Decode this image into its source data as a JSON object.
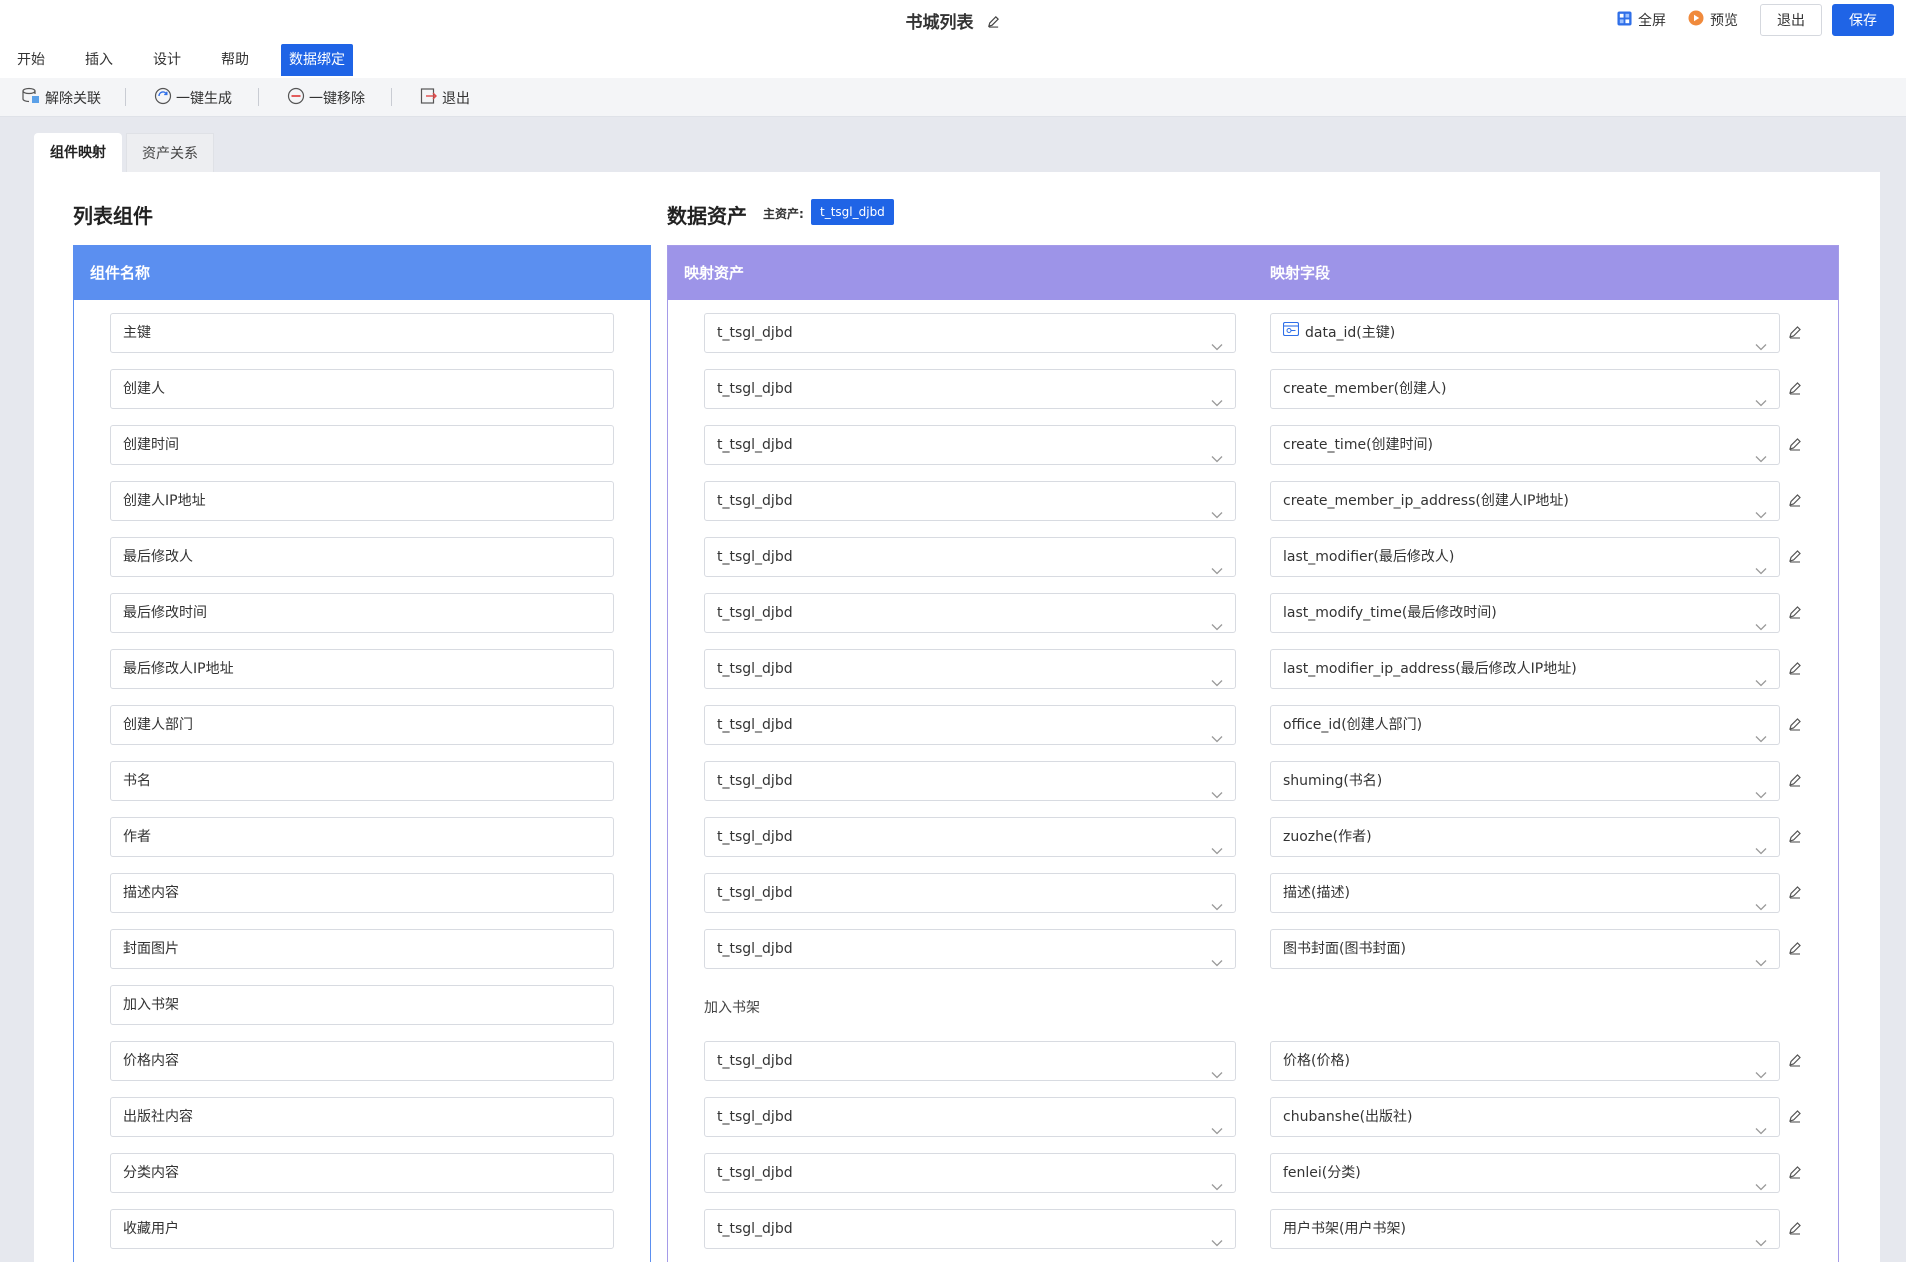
{
  "app": {
    "title": "书城列表",
    "fullscreen": "全屏",
    "preview": "预览",
    "exit": "退出",
    "save": "保存"
  },
  "menu": [
    "开始",
    "插入",
    "设计",
    "帮助",
    "数据绑定"
  ],
  "toolbar": {
    "unlink": "解除关联",
    "generate": "一键生成",
    "remove": "一键移除",
    "exit": "退出"
  },
  "tabs": {
    "mapping": "组件映射",
    "relation": "资产关系"
  },
  "left": {
    "title": "列表组件",
    "header": "组件名称",
    "components": [
      "主键",
      "创建人",
      "创建时间",
      "创建人IP地址",
      "最后修改人",
      "最后修改时间",
      "最后修改人IP地址",
      "创建人部门",
      "书名",
      "作者",
      "描述内容",
      "封面图片",
      "加入书架",
      "价格内容",
      "出版社内容",
      "分类内容",
      "收藏用户"
    ]
  },
  "right": {
    "title": "数据资产",
    "main_asset_label": "主资产:",
    "main_asset": "t_tsgl_djbd",
    "header_asset": "映射资产",
    "header_field": "映射字段",
    "group_label": "加入书架",
    "rows": [
      {
        "asset": "t_tsgl_djbd",
        "field": "data_id(主键)"
      },
      {
        "asset": "t_tsgl_djbd",
        "field": "create_member(创建人)"
      },
      {
        "asset": "t_tsgl_djbd",
        "field": "create_time(创建时间)"
      },
      {
        "asset": "t_tsgl_djbd",
        "field": "create_member_ip_address(创建人IP地址)"
      },
      {
        "asset": "t_tsgl_djbd",
        "field": "last_modifier(最后修改人)"
      },
      {
        "asset": "t_tsgl_djbd",
        "field": "last_modify_time(最后修改时间)"
      },
      {
        "asset": "t_tsgl_djbd",
        "field": "last_modifier_ip_address(最后修改人IP地址)"
      },
      {
        "asset": "t_tsgl_djbd",
        "field": "office_id(创建人部门)"
      },
      {
        "asset": "t_tsgl_djbd",
        "field": "shuming(书名)"
      },
      {
        "asset": "t_tsgl_djbd",
        "field": "zuozhe(作者)"
      },
      {
        "asset": "t_tsgl_djbd",
        "field": "描述(描述)"
      },
      {
        "asset": "t_tsgl_djbd",
        "field": "图书封面(图书封面)"
      },
      {
        "asset": "t_tsgl_djbd",
        "field": "价格(价格)"
      },
      {
        "asset": "t_tsgl_djbd",
        "field": "chubanshe(出版社)"
      },
      {
        "asset": "t_tsgl_djbd",
        "field": "fenlei(分类)"
      },
      {
        "asset": "t_tsgl_djbd",
        "field": "用户书架(用户书架)"
      }
    ]
  },
  "colors": {
    "primary": "#1f64e6",
    "left_header": "#5b8ff0",
    "right_header": "#9d94e8"
  }
}
